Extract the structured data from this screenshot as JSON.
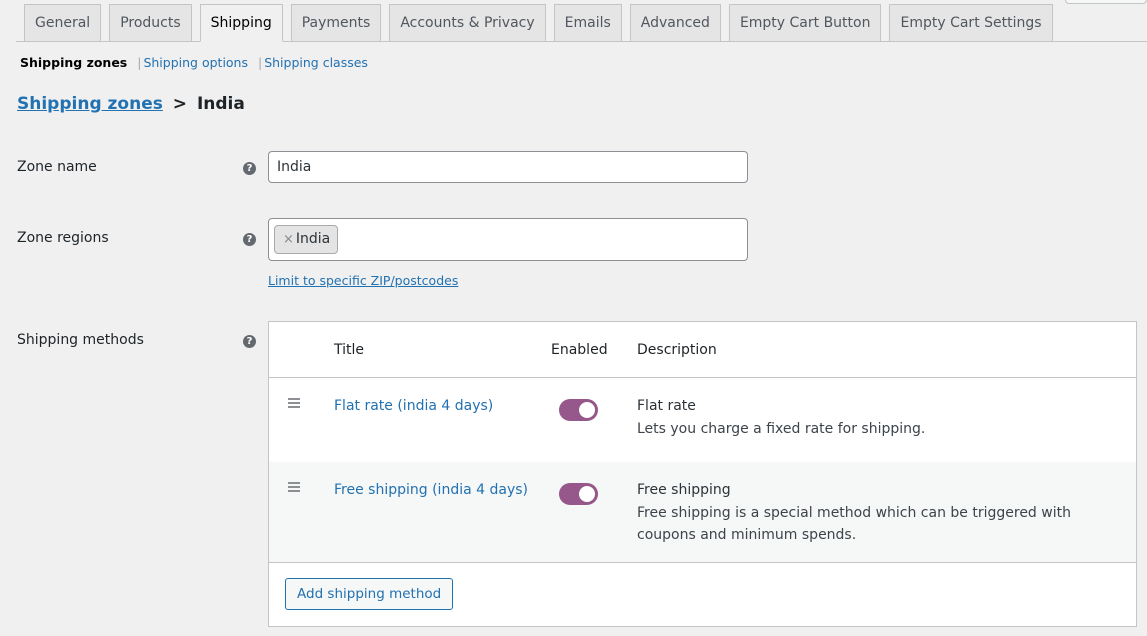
{
  "tabs": [
    {
      "label": "General",
      "active": false
    },
    {
      "label": "Products",
      "active": false
    },
    {
      "label": "Shipping",
      "active": true
    },
    {
      "label": "Payments",
      "active": false
    },
    {
      "label": "Accounts & Privacy",
      "active": false
    },
    {
      "label": "Emails",
      "active": false
    },
    {
      "label": "Advanced",
      "active": false
    },
    {
      "label": "Empty Cart Button",
      "active": false
    },
    {
      "label": "Empty Cart Settings",
      "active": false
    }
  ],
  "subnav": {
    "current": "Shipping zones",
    "links": [
      "Shipping options",
      "Shipping classes"
    ],
    "separator": "|"
  },
  "breadcrumb": {
    "link": "Shipping zones",
    "separator": ">",
    "current": "India"
  },
  "form": {
    "zone_name": {
      "label": "Zone name",
      "value": "India"
    },
    "zone_regions": {
      "label": "Zone regions",
      "chips": [
        "India"
      ],
      "remove_glyph": "×",
      "limit_link": "Limit to specific ZIP/postcodes"
    },
    "shipping_methods": {
      "label": "Shipping methods",
      "columns": {
        "title": "Title",
        "enabled": "Enabled",
        "description": "Description"
      },
      "rows": [
        {
          "title": "Flat rate (india 4 days)",
          "enabled": true,
          "desc_title": "Flat rate",
          "desc_text": "Lets you charge a fixed rate for shipping."
        },
        {
          "title": "Free shipping (india 4 days)",
          "enabled": true,
          "desc_title": "Free shipping",
          "desc_text": "Free shipping is a special method which can be triggered with coupons and minimum spends."
        }
      ],
      "add_button": "Add shipping method"
    },
    "help_glyph": "?"
  },
  "colors": {
    "accent_link": "#2271b1",
    "toggle_on": "#96588a"
  }
}
